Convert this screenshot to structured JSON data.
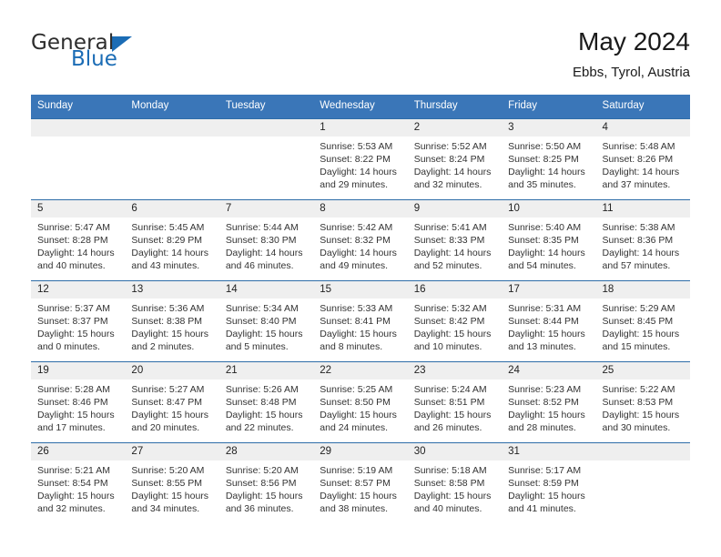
{
  "brand": {
    "line1": "General",
    "line2": "Blue",
    "triangle_color": "#1b6cb5",
    "icon": "triangle-logo-icon"
  },
  "header": {
    "title": "May 2024",
    "subtitle": "Ebbs, Tyrol, Austria"
  },
  "theme": {
    "header_blue": "#3a76b8",
    "week_divider_blue": "#2e6da8",
    "daynum_gray": "#efefef",
    "text_dark": "#222222"
  },
  "weekdays": [
    "Sunday",
    "Monday",
    "Tuesday",
    "Wednesday",
    "Thursday",
    "Friday",
    "Saturday"
  ],
  "weeks": [
    {
      "days": [
        {
          "num": "",
          "sunrise": "",
          "sunset": "",
          "daylight_a": "",
          "daylight_b": ""
        },
        {
          "num": "",
          "sunrise": "",
          "sunset": "",
          "daylight_a": "",
          "daylight_b": ""
        },
        {
          "num": "",
          "sunrise": "",
          "sunset": "",
          "daylight_a": "",
          "daylight_b": ""
        },
        {
          "num": "1",
          "sunrise": "Sunrise: 5:53 AM",
          "sunset": "Sunset: 8:22 PM",
          "daylight_a": "Daylight: 14 hours",
          "daylight_b": "and 29 minutes."
        },
        {
          "num": "2",
          "sunrise": "Sunrise: 5:52 AM",
          "sunset": "Sunset: 8:24 PM",
          "daylight_a": "Daylight: 14 hours",
          "daylight_b": "and 32 minutes."
        },
        {
          "num": "3",
          "sunrise": "Sunrise: 5:50 AM",
          "sunset": "Sunset: 8:25 PM",
          "daylight_a": "Daylight: 14 hours",
          "daylight_b": "and 35 minutes."
        },
        {
          "num": "4",
          "sunrise": "Sunrise: 5:48 AM",
          "sunset": "Sunset: 8:26 PM",
          "daylight_a": "Daylight: 14 hours",
          "daylight_b": "and 37 minutes."
        }
      ]
    },
    {
      "days": [
        {
          "num": "5",
          "sunrise": "Sunrise: 5:47 AM",
          "sunset": "Sunset: 8:28 PM",
          "daylight_a": "Daylight: 14 hours",
          "daylight_b": "and 40 minutes."
        },
        {
          "num": "6",
          "sunrise": "Sunrise: 5:45 AM",
          "sunset": "Sunset: 8:29 PM",
          "daylight_a": "Daylight: 14 hours",
          "daylight_b": "and 43 minutes."
        },
        {
          "num": "7",
          "sunrise": "Sunrise: 5:44 AM",
          "sunset": "Sunset: 8:30 PM",
          "daylight_a": "Daylight: 14 hours",
          "daylight_b": "and 46 minutes."
        },
        {
          "num": "8",
          "sunrise": "Sunrise: 5:42 AM",
          "sunset": "Sunset: 8:32 PM",
          "daylight_a": "Daylight: 14 hours",
          "daylight_b": "and 49 minutes."
        },
        {
          "num": "9",
          "sunrise": "Sunrise: 5:41 AM",
          "sunset": "Sunset: 8:33 PM",
          "daylight_a": "Daylight: 14 hours",
          "daylight_b": "and 52 minutes."
        },
        {
          "num": "10",
          "sunrise": "Sunrise: 5:40 AM",
          "sunset": "Sunset: 8:35 PM",
          "daylight_a": "Daylight: 14 hours",
          "daylight_b": "and 54 minutes."
        },
        {
          "num": "11",
          "sunrise": "Sunrise: 5:38 AM",
          "sunset": "Sunset: 8:36 PM",
          "daylight_a": "Daylight: 14 hours",
          "daylight_b": "and 57 minutes."
        }
      ]
    },
    {
      "days": [
        {
          "num": "12",
          "sunrise": "Sunrise: 5:37 AM",
          "sunset": "Sunset: 8:37 PM",
          "daylight_a": "Daylight: 15 hours",
          "daylight_b": "and 0 minutes."
        },
        {
          "num": "13",
          "sunrise": "Sunrise: 5:36 AM",
          "sunset": "Sunset: 8:38 PM",
          "daylight_a": "Daylight: 15 hours",
          "daylight_b": "and 2 minutes."
        },
        {
          "num": "14",
          "sunrise": "Sunrise: 5:34 AM",
          "sunset": "Sunset: 8:40 PM",
          "daylight_a": "Daylight: 15 hours",
          "daylight_b": "and 5 minutes."
        },
        {
          "num": "15",
          "sunrise": "Sunrise: 5:33 AM",
          "sunset": "Sunset: 8:41 PM",
          "daylight_a": "Daylight: 15 hours",
          "daylight_b": "and 8 minutes."
        },
        {
          "num": "16",
          "sunrise": "Sunrise: 5:32 AM",
          "sunset": "Sunset: 8:42 PM",
          "daylight_a": "Daylight: 15 hours",
          "daylight_b": "and 10 minutes."
        },
        {
          "num": "17",
          "sunrise": "Sunrise: 5:31 AM",
          "sunset": "Sunset: 8:44 PM",
          "daylight_a": "Daylight: 15 hours",
          "daylight_b": "and 13 minutes."
        },
        {
          "num": "18",
          "sunrise": "Sunrise: 5:29 AM",
          "sunset": "Sunset: 8:45 PM",
          "daylight_a": "Daylight: 15 hours",
          "daylight_b": "and 15 minutes."
        }
      ]
    },
    {
      "days": [
        {
          "num": "19",
          "sunrise": "Sunrise: 5:28 AM",
          "sunset": "Sunset: 8:46 PM",
          "daylight_a": "Daylight: 15 hours",
          "daylight_b": "and 17 minutes."
        },
        {
          "num": "20",
          "sunrise": "Sunrise: 5:27 AM",
          "sunset": "Sunset: 8:47 PM",
          "daylight_a": "Daylight: 15 hours",
          "daylight_b": "and 20 minutes."
        },
        {
          "num": "21",
          "sunrise": "Sunrise: 5:26 AM",
          "sunset": "Sunset: 8:48 PM",
          "daylight_a": "Daylight: 15 hours",
          "daylight_b": "and 22 minutes."
        },
        {
          "num": "22",
          "sunrise": "Sunrise: 5:25 AM",
          "sunset": "Sunset: 8:50 PM",
          "daylight_a": "Daylight: 15 hours",
          "daylight_b": "and 24 minutes."
        },
        {
          "num": "23",
          "sunrise": "Sunrise: 5:24 AM",
          "sunset": "Sunset: 8:51 PM",
          "daylight_a": "Daylight: 15 hours",
          "daylight_b": "and 26 minutes."
        },
        {
          "num": "24",
          "sunrise": "Sunrise: 5:23 AM",
          "sunset": "Sunset: 8:52 PM",
          "daylight_a": "Daylight: 15 hours",
          "daylight_b": "and 28 minutes."
        },
        {
          "num": "25",
          "sunrise": "Sunrise: 5:22 AM",
          "sunset": "Sunset: 8:53 PM",
          "daylight_a": "Daylight: 15 hours",
          "daylight_b": "and 30 minutes."
        }
      ]
    },
    {
      "days": [
        {
          "num": "26",
          "sunrise": "Sunrise: 5:21 AM",
          "sunset": "Sunset: 8:54 PM",
          "daylight_a": "Daylight: 15 hours",
          "daylight_b": "and 32 minutes."
        },
        {
          "num": "27",
          "sunrise": "Sunrise: 5:20 AM",
          "sunset": "Sunset: 8:55 PM",
          "daylight_a": "Daylight: 15 hours",
          "daylight_b": "and 34 minutes."
        },
        {
          "num": "28",
          "sunrise": "Sunrise: 5:20 AM",
          "sunset": "Sunset: 8:56 PM",
          "daylight_a": "Daylight: 15 hours",
          "daylight_b": "and 36 minutes."
        },
        {
          "num": "29",
          "sunrise": "Sunrise: 5:19 AM",
          "sunset": "Sunset: 8:57 PM",
          "daylight_a": "Daylight: 15 hours",
          "daylight_b": "and 38 minutes."
        },
        {
          "num": "30",
          "sunrise": "Sunrise: 5:18 AM",
          "sunset": "Sunset: 8:58 PM",
          "daylight_a": "Daylight: 15 hours",
          "daylight_b": "and 40 minutes."
        },
        {
          "num": "31",
          "sunrise": "Sunrise: 5:17 AM",
          "sunset": "Sunset: 8:59 PM",
          "daylight_a": "Daylight: 15 hours",
          "daylight_b": "and 41 minutes."
        },
        {
          "num": "",
          "sunrise": "",
          "sunset": "",
          "daylight_a": "",
          "daylight_b": ""
        }
      ]
    }
  ]
}
